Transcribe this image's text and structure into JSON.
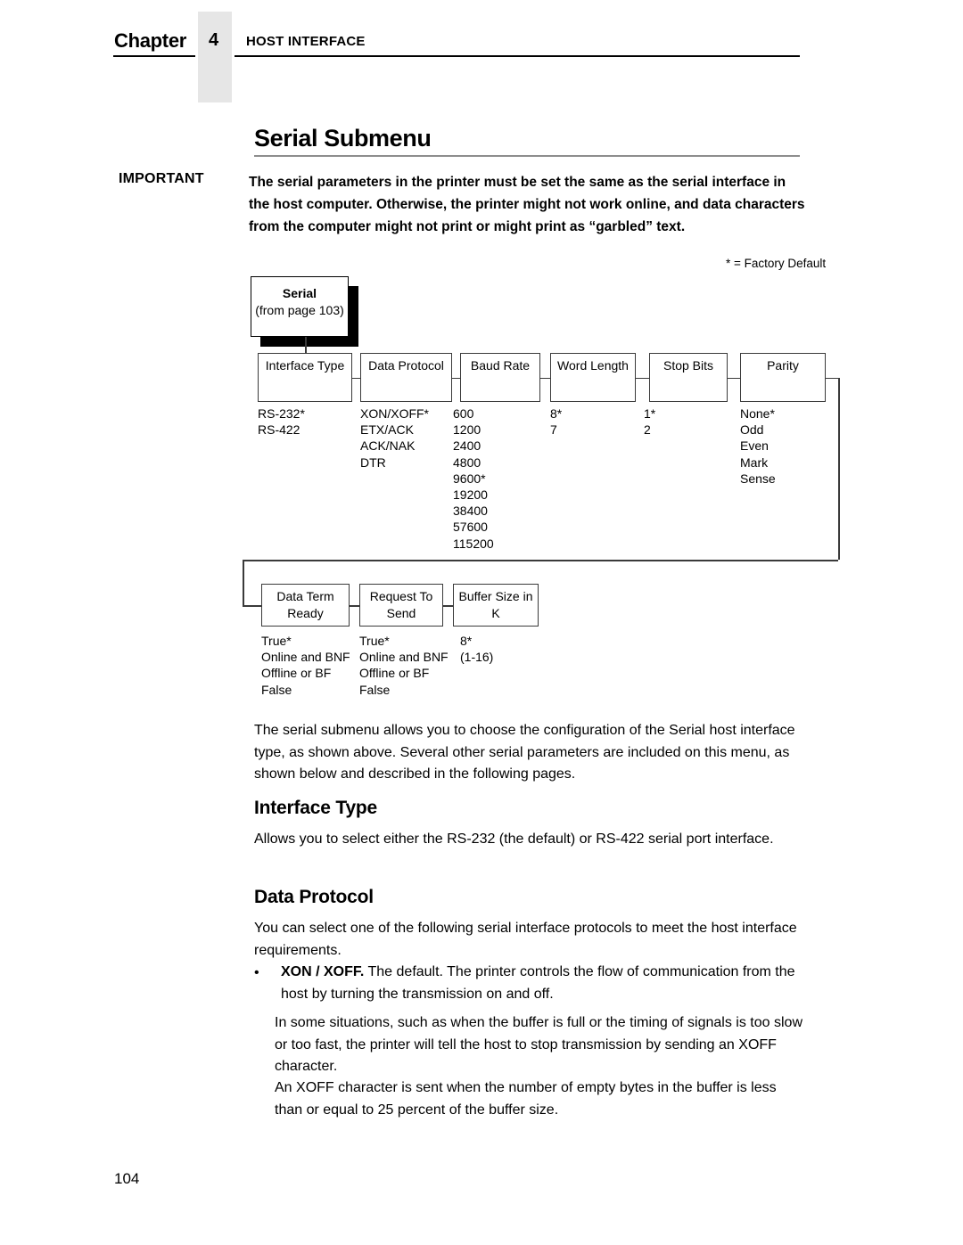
{
  "header": {
    "chapter_label": "Chapter",
    "chapter_number": "4",
    "chapter_title": "HOST INTERFACE"
  },
  "section": {
    "title": "Serial Submenu"
  },
  "important": {
    "label": "IMPORTANT",
    "body": "The serial parameters in the printer must be set the same as the serial interface in the host computer. Otherwise, the printer might not work online, and data characters from the computer might not print or might print as “garbled” text."
  },
  "diagram": {
    "factory_default_note": "* = Factory Default",
    "root_box": {
      "title": "Serial",
      "subtitle": "(from page 103)"
    },
    "row1": [
      {
        "label": "Interface Type",
        "label_line2": "",
        "values": [
          "RS-232*",
          "RS-422"
        ]
      },
      {
        "label": "Data Protocol",
        "label_line2": "",
        "values": [
          "XON/XOFF*",
          "ETX/ACK",
          "ACK/NAK",
          "DTR"
        ]
      },
      {
        "label": "Baud Rate",
        "label_line2": "",
        "values": [
          "600",
          "1200",
          "2400",
          "4800",
          "9600*",
          "19200",
          "38400",
          "57600",
          "115200"
        ]
      },
      {
        "label": "Word Length",
        "label_line2": "",
        "values": [
          "8*",
          "7"
        ]
      },
      {
        "label": "Stop Bits",
        "label_line2": "",
        "values": [
          "1*",
          "2"
        ]
      },
      {
        "label": "Parity",
        "label_line2": "",
        "values": [
          "None*",
          "Odd",
          "Even",
          "Mark",
          "Sense"
        ]
      }
    ],
    "row2": [
      {
        "label": "Data Term",
        "label_line2": "Ready",
        "values": [
          "True*",
          "Online and BNF",
          "Offline or BF",
          "False"
        ]
      },
      {
        "label": "Request To",
        "label_line2": "Send",
        "values": [
          "True*",
          "Online and BNF",
          "Offline or BF",
          "False"
        ]
      },
      {
        "label": "Buffer Size in",
        "label_line2": "K",
        "values": [
          "8*",
          "(1-16)"
        ]
      }
    ]
  },
  "content": {
    "intro_para": "The serial submenu allows you to choose the configuration of the Serial host interface type, as shown above. Several other serial parameters are included on this menu, as shown below and described in the following pages.",
    "interface_type_head": "Interface Type",
    "interface_type_para": "Allows you to select either the RS-232 (the default) or RS-422 serial port interface.",
    "data_protocol_head": "Data Protocol",
    "data_protocol_para": "You can select one of the following serial interface protocols to meet the host interface requirements.",
    "bullet_marker": "•",
    "bullet_bold": "XON / XOFF.",
    "bullet_rest": " The default. The printer controls the flow of communication from the host by turning the transmission on and off.",
    "para_xoff_1": "In some situations, such as when the buffer is full or the timing of signals is too slow or too fast, the printer will tell the host to stop transmission by sending an XOFF character.",
    "para_xoff_2": "An XOFF character is sent when the number of empty bytes in the buffer is less than or equal to 25 percent of the buffer size."
  },
  "footer": {
    "page_number": "104"
  },
  "colors": {
    "gray_block": "#e6e6e6",
    "rule": "#000000",
    "title_rule": "#8d8d8d",
    "box_border": "#3a3a3a"
  }
}
